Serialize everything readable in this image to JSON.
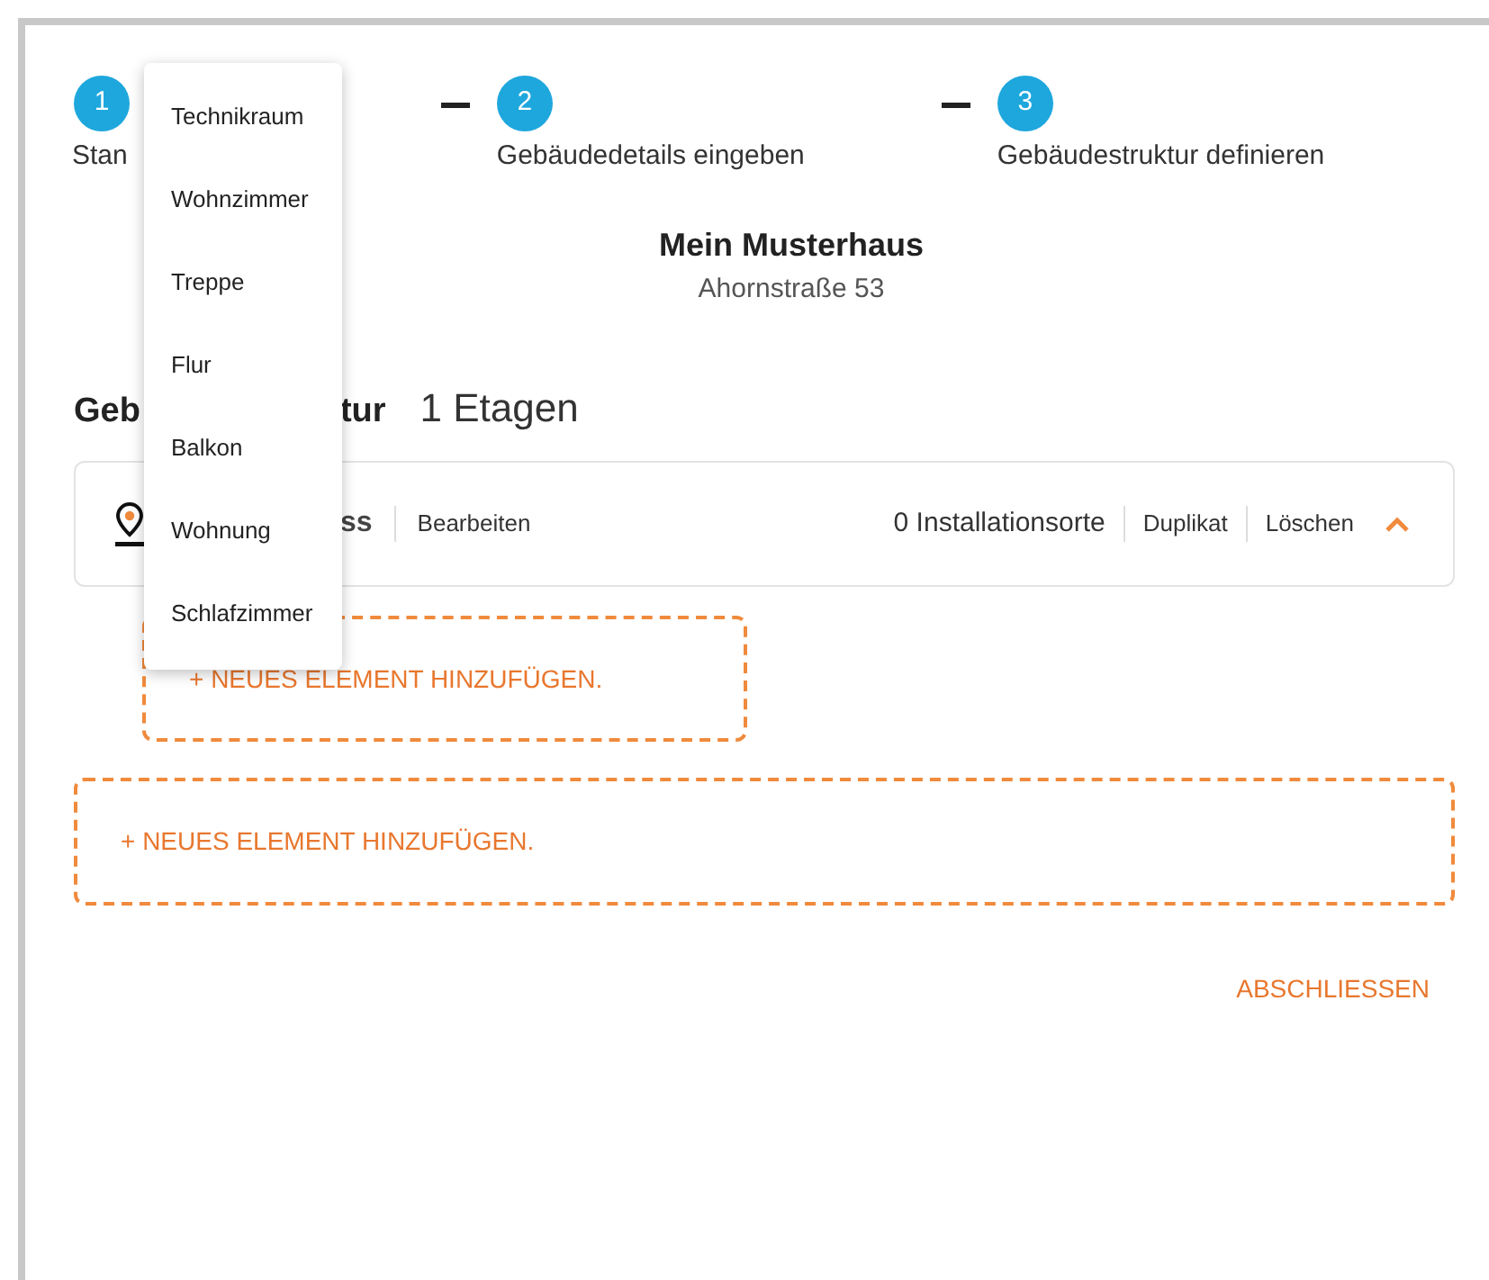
{
  "steps": [
    {
      "number": "1",
      "label": "Stan"
    },
    {
      "number": "2",
      "label": "Gebäudedetails eingeben"
    },
    {
      "number": "3",
      "label": "Gebäudestruktur definieren"
    }
  ],
  "building": {
    "name": "Mein Musterhaus",
    "address": "Ahornstraße 53"
  },
  "structure": {
    "heading_parts": [
      "Geb",
      "tur"
    ],
    "count": "1 Etagen"
  },
  "floors": [
    {
      "name": "ss",
      "edit": "Bearbeiten",
      "locations": "0 Installationsorte",
      "duplicate": "Duplikat",
      "delete": "Löschen",
      "expanded": true,
      "add_label": "+ NEUES ELEMENT HINZUFÜGEN."
    }
  ],
  "add_floor": "+ NEUES ELEMENT HINZUFÜGEN.",
  "finish": "ABSCHLIESSEN",
  "menu": {
    "items": [
      "Technikraum",
      "Wohnzimmer",
      "Treppe",
      "Flur",
      "Balkon",
      "Wohnung",
      "Schlafzimmer"
    ]
  }
}
